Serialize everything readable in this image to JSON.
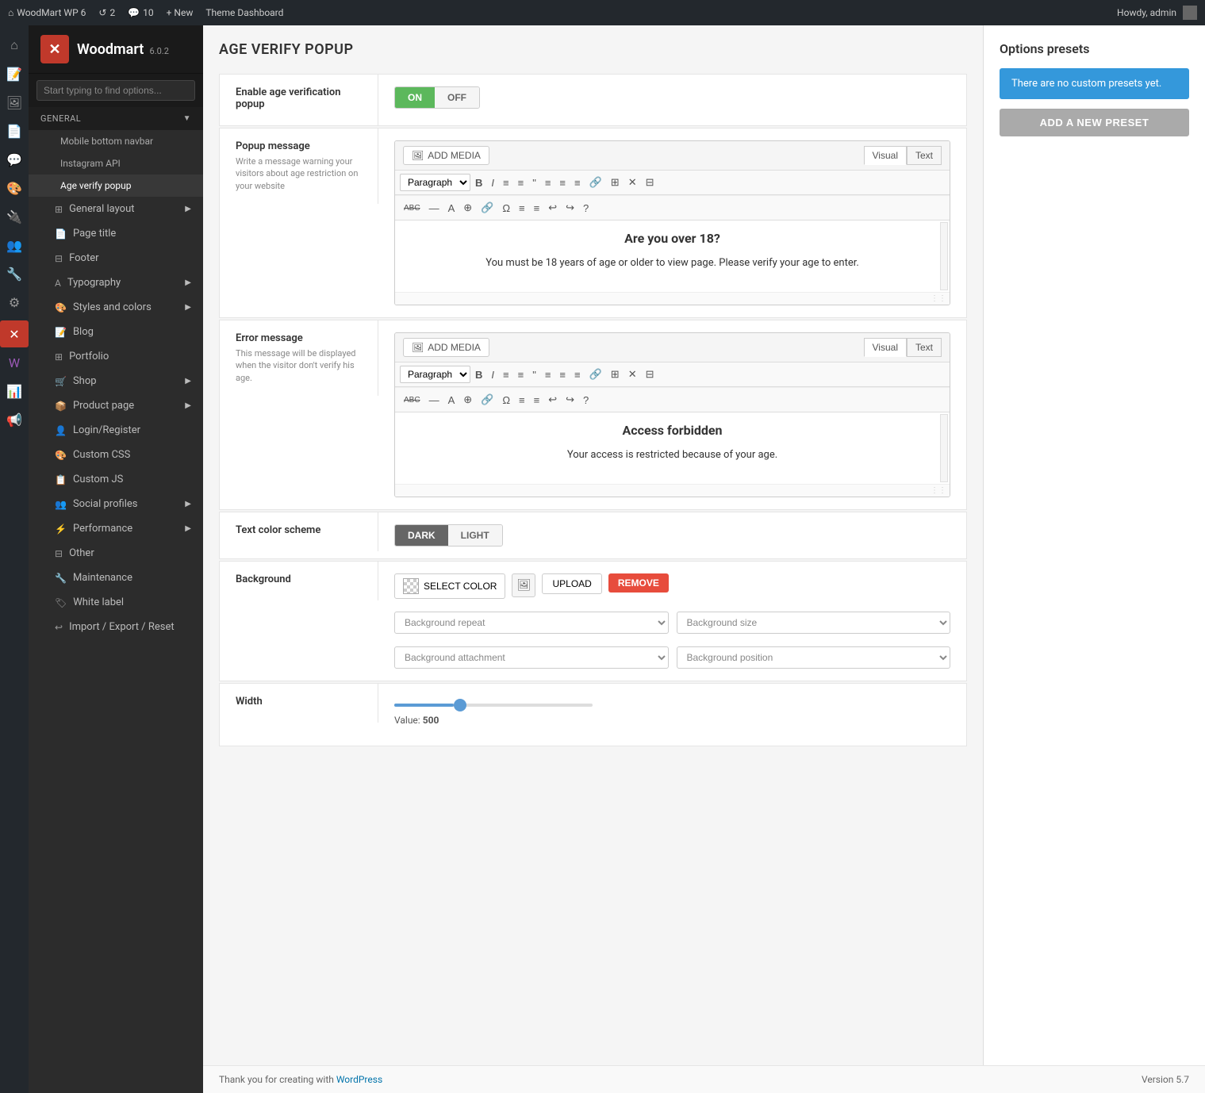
{
  "admin_bar": {
    "site_name": "WoodMart WP 6",
    "comments_count": "2",
    "updates_count": "10",
    "new_label": "+ New",
    "theme_dashboard": "Theme Dashboard",
    "howdy": "Howdy, admin"
  },
  "theme": {
    "name": "Woodmart",
    "version": "6.0.2",
    "search_placeholder": "Start typing to find options...",
    "logo_text": "✕"
  },
  "sidebar": {
    "general_label": "General",
    "items": [
      {
        "label": "Mobile bottom navbar",
        "icon": "📱"
      },
      {
        "label": "Instagram API",
        "icon": "📷"
      },
      {
        "label": "Age verify popup",
        "icon": "🔞",
        "active": true
      }
    ],
    "sections": [
      {
        "label": "General layout",
        "icon": "⊞",
        "has_arrow": true
      },
      {
        "label": "Page title",
        "icon": "📄",
        "has_arrow": false
      },
      {
        "label": "Footer",
        "icon": "⊟",
        "has_arrow": false
      },
      {
        "label": "Typography",
        "icon": "A",
        "has_arrow": true
      },
      {
        "label": "Styles and colors",
        "icon": "🎨",
        "has_arrow": true
      },
      {
        "label": "Blog",
        "icon": "📝",
        "has_arrow": false
      },
      {
        "label": "Portfolio",
        "icon": "⊞",
        "has_arrow": false
      },
      {
        "label": "Shop",
        "icon": "🛒",
        "has_arrow": true
      },
      {
        "label": "Product page",
        "icon": "📦",
        "has_arrow": true
      },
      {
        "label": "Login/Register",
        "icon": "👤",
        "has_arrow": false
      },
      {
        "label": "Custom CSS",
        "icon": "🎨",
        "has_arrow": false
      },
      {
        "label": "Custom JS",
        "icon": "📋",
        "has_arrow": false
      },
      {
        "label": "Social profiles",
        "icon": "👥",
        "has_arrow": true
      },
      {
        "label": "Performance",
        "icon": "⚡",
        "has_arrow": true
      },
      {
        "label": "Other",
        "icon": "⊟",
        "has_arrow": false
      },
      {
        "label": "Maintenance",
        "icon": "🔧",
        "has_arrow": false
      },
      {
        "label": "White label",
        "icon": "🏷",
        "has_arrow": false
      },
      {
        "label": "Import / Export / Reset",
        "icon": "↩",
        "has_arrow": false
      }
    ]
  },
  "page": {
    "title": "AGE VERIFY POPUP",
    "options": [
      {
        "id": "enable_age_verification",
        "label": "Enable age verification popup",
        "desc": "",
        "type": "toggle",
        "value": "ON"
      },
      {
        "id": "popup_message",
        "label": "Popup message",
        "desc": "Write a message warning your visitors about age restriction on your website",
        "type": "editor",
        "content_line1": "Are you over 18?",
        "content_line2": "You must be 18 years of age or older to view page. Please verify your age to enter."
      },
      {
        "id": "error_message",
        "label": "Error message",
        "desc": "This message will be displayed when the visitor don't verify his age.",
        "type": "editor",
        "content_line1": "Access forbidden",
        "content_line2": "Your access is restricted because of your age."
      },
      {
        "id": "text_color_scheme",
        "label": "Text color scheme",
        "desc": "",
        "type": "color_scheme",
        "value": "DARK"
      },
      {
        "id": "background",
        "label": "Background",
        "desc": "",
        "type": "background"
      },
      {
        "id": "width",
        "label": "Width",
        "desc": "",
        "type": "slider",
        "value": "500",
        "slider_percent": 30
      }
    ]
  },
  "editor": {
    "add_media_label": "ADD MEDIA",
    "visual_tab": "Visual",
    "text_tab": "Text",
    "format_options": [
      "Paragraph"
    ],
    "toolbar_buttons": [
      "B",
      "I",
      "≡",
      "≡",
      "\"",
      "≡",
      "≡",
      "≡",
      "🔗",
      "⊞",
      "✕",
      "⊟"
    ],
    "toolbar2_buttons": [
      "ABC",
      "—",
      "A",
      "⊕",
      "🔗",
      "Ω",
      "≡",
      "≡",
      "↩",
      "↪",
      "?"
    ]
  },
  "background": {
    "select_color_label": "SELECT COLOR",
    "upload_label": "UPLOAD",
    "remove_label": "REMOVE",
    "repeat_placeholder": "Background repeat",
    "size_placeholder": "Background size",
    "attachment_placeholder": "Background attachment",
    "position_placeholder": "Background position"
  },
  "slider": {
    "value_prefix": "Value:",
    "value": "500"
  },
  "presets": {
    "title": "Options presets",
    "info_text": "There are no custom presets yet.",
    "add_button_label": "ADD A NEW PRESET"
  },
  "footer": {
    "thanks_text": "Thank you for creating with ",
    "wp_link_label": "WordPress",
    "version_text": "Version 5.7"
  }
}
